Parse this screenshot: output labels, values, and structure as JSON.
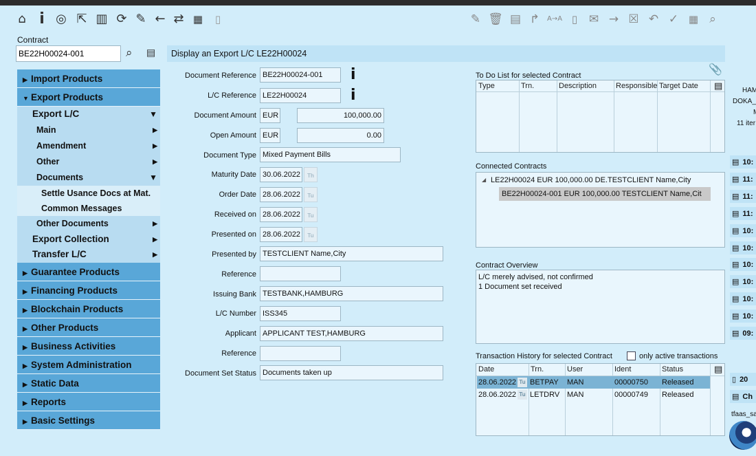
{
  "toolbar": {
    "left_icons": [
      "home-icon",
      "info-icon",
      "target-icon",
      "shortcut-icon",
      "book-icon",
      "refresh-folder-icon",
      "edit-icon",
      "back-arrow-icon",
      "sync-icon",
      "calendar-icon",
      "info-box-icon"
    ],
    "right_icons": [
      "edit-doc-icon",
      "delete-icon",
      "attach-doc-icon",
      "forward-icon",
      "translate-icon",
      "info-box-icon",
      "mail-icon",
      "arrow-right-icon",
      "close-box-icon",
      "undo-icon",
      "check-icon",
      "calendar-icon",
      "search-icon"
    ]
  },
  "contract": {
    "label": "Contract",
    "value": "BE22H00024-001"
  },
  "title": "Display an Export L/C LE22H00024",
  "sidebar": [
    {
      "label": "Import Products",
      "level": 0,
      "arrow": "right"
    },
    {
      "label": "Export Products",
      "level": 0,
      "arrow": "down"
    },
    {
      "label": "Export L/C",
      "level": 1,
      "rarrow": "down"
    },
    {
      "label": "Main",
      "level": 2,
      "rarrow": "right"
    },
    {
      "label": "Amendment",
      "level": 2,
      "rarrow": "right"
    },
    {
      "label": "Other",
      "level": 2,
      "rarrow": "right"
    },
    {
      "label": "Documents",
      "level": 2,
      "rarrow": "down"
    },
    {
      "label": "Settle Usance Docs at Mat.",
      "level": 3
    },
    {
      "label": "Common Messages",
      "level": 3
    },
    {
      "label": "Other Documents",
      "level": 2,
      "rarrow": "right"
    },
    {
      "label": "Export Collection",
      "level": 1,
      "rarrow": "right"
    },
    {
      "label": "Transfer L/C",
      "level": 1,
      "rarrow": "right"
    },
    {
      "label": "Guarantee Products",
      "level": 0,
      "arrow": "right"
    },
    {
      "label": "Financing Products",
      "level": 0,
      "arrow": "right"
    },
    {
      "label": "Blockchain Products",
      "level": 0,
      "arrow": "right"
    },
    {
      "label": "Other Products",
      "level": 0,
      "arrow": "right"
    },
    {
      "label": "Business Activities",
      "level": 0,
      "arrow": "right"
    },
    {
      "label": "System Administration",
      "level": 0,
      "arrow": "right"
    },
    {
      "label": "Static Data",
      "level": 0,
      "arrow": "right"
    },
    {
      "label": "Reports",
      "level": 0,
      "arrow": "right"
    },
    {
      "label": "Basic Settings",
      "level": 0,
      "arrow": "right"
    }
  ],
  "form": {
    "doc_ref_label": "Document Reference",
    "doc_ref": "BE22H00024-001",
    "lc_ref_label": "L/C Reference",
    "lc_ref": "LE22H00024",
    "doc_amount_label": "Document Amount",
    "doc_amount_ccy": "EUR",
    "doc_amount": "100,000.00",
    "open_amount_label": "Open Amount",
    "open_amount_ccy": "EUR",
    "open_amount": "0.00",
    "doc_type_label": "Document Type",
    "doc_type": "Mixed Payment Bills",
    "maturity_label": "Maturity Date",
    "maturity": "30.06.2022",
    "maturity_cal": "Th",
    "order_label": "Order Date",
    "order": "28.06.2022",
    "order_cal": "Tu",
    "received_label": "Received on",
    "received": "28.06.2022",
    "received_cal": "Tu",
    "presented_label": "Presented on",
    "presented": "28.06.2022",
    "presented_cal": "Tu",
    "presented_by_label": "Presented by",
    "presented_by": "TESTCLIENT Name,City",
    "reference1_label": "Reference",
    "reference1": "",
    "issuing_bank_label": "Issuing Bank",
    "issuing_bank": "TESTBANK,HAMBURG",
    "lc_number_label": "L/C Number",
    "lc_number": "ISS345",
    "applicant_label": "Applicant",
    "applicant": "APPLICANT TEST,HAMBURG",
    "reference2_label": "Reference",
    "reference2": "",
    "doc_set_status_label": "Document Set Status",
    "doc_set_status": "Documents taken up"
  },
  "todo": {
    "title": "To Do List for selected Contract",
    "columns": [
      "Type",
      "Trn.",
      "Description",
      "Responsible",
      "Target Date"
    ]
  },
  "connected": {
    "title": "Connected Contracts",
    "parent": "LE22H00024 EUR 100,000.00 DE.TESTCLIENT Name,City",
    "child": "BE22H00024-001 EUR 100,000.00 TESTCLIENT Name,Cit"
  },
  "overview": {
    "title": "Contract Overview",
    "lines": [
      "L/C merely advised, not confirmed",
      "1 Document set received"
    ]
  },
  "history": {
    "title": "Transaction History for selected Contract",
    "only_active_label": "only active transactions",
    "columns": [
      "Date",
      "Trn.",
      "User",
      "Ident",
      "Status"
    ],
    "rows": [
      {
        "date": "28.06.2022",
        "cal": "Tu",
        "trn": "BETPAY",
        "user": "MAN",
        "ident": "00000750",
        "status": "Released"
      },
      {
        "date": "28.06.2022",
        "cal": "Tu",
        "trn": "LETDRV",
        "user": "MAN",
        "ident": "00000749",
        "status": "Released"
      }
    ]
  },
  "rightpanel": {
    "lines": [
      "HAM",
      "DOKA_",
      "M",
      "11 iter"
    ],
    "history_times": [
      "10:",
      "11:",
      "11:",
      "11:",
      "10:",
      "10:",
      "10:",
      "10:",
      "10:",
      "10:",
      "09:"
    ],
    "bottom_items": [
      "20",
      "Ch"
    ],
    "user": "tfaas_sa"
  }
}
